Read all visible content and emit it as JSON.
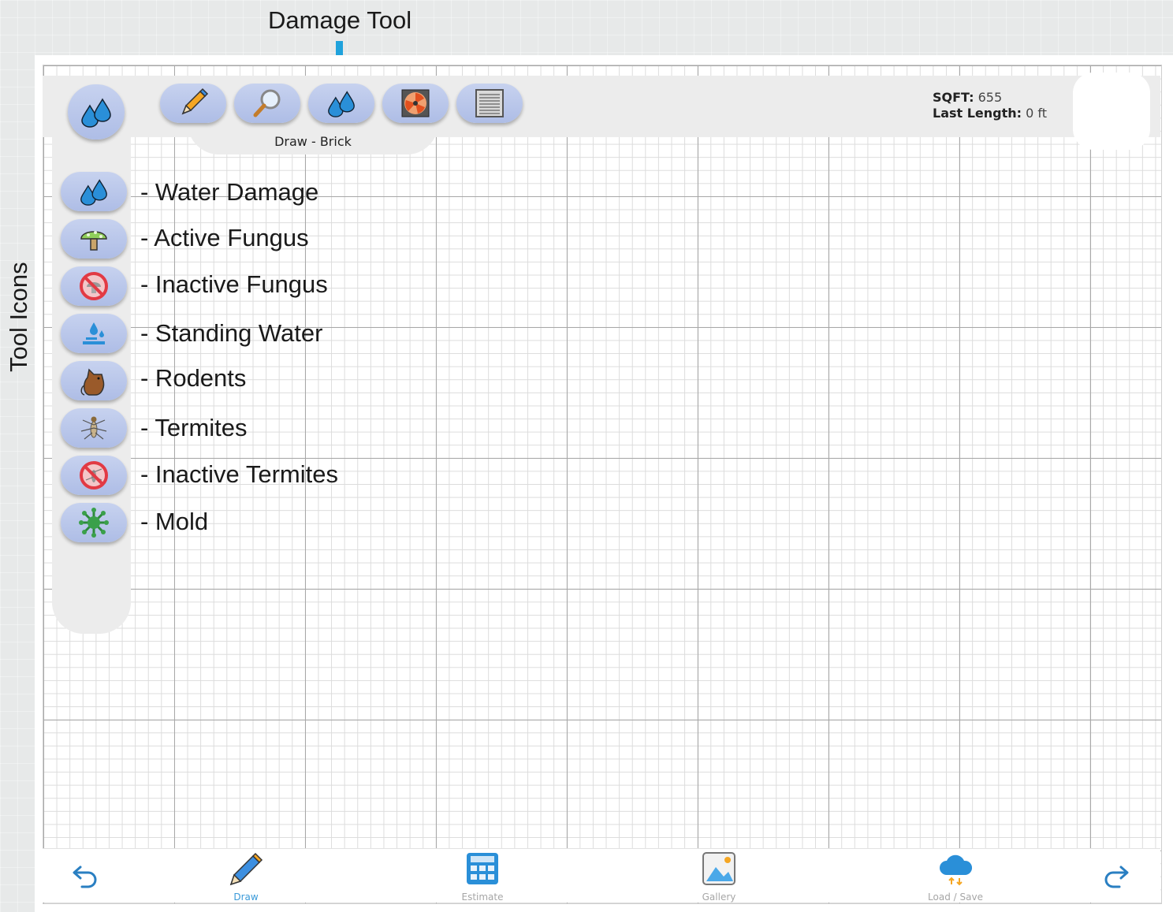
{
  "annotations": {
    "top_label": "Damage Tool",
    "left_label": "Tool Icons"
  },
  "toolbar": {
    "tools": [
      {
        "icon": "pencil-icon"
      },
      {
        "icon": "magnifier-icon"
      },
      {
        "icon": "water-drops-icon"
      },
      {
        "icon": "fan-icon"
      },
      {
        "icon": "panel-icon"
      }
    ],
    "caption": "Draw - Brick"
  },
  "stats": {
    "sqft_label": "SQFT:",
    "sqft_value": "655",
    "length_label": "Last Length:",
    "length_value": "0 ft"
  },
  "damage_tools": [
    {
      "label": "- Water Damage",
      "icon": "water-drops-icon"
    },
    {
      "label": "- Active Fungus",
      "icon": "mushroom-icon"
    },
    {
      "label": "- Inactive Fungus",
      "icon": "inactive-fungus-icon"
    },
    {
      "label": "- Standing Water",
      "icon": "standing-water-icon"
    },
    {
      "label": "- Rodents",
      "icon": "rodent-icon"
    },
    {
      "label": "- Termites",
      "icon": "termite-icon"
    },
    {
      "label": "- Inactive Termites",
      "icon": "inactive-termite-icon"
    },
    {
      "label": "- Mold",
      "icon": "mold-icon"
    }
  ],
  "bottom_nav": {
    "draw": "Draw",
    "estimate": "Estimate",
    "gallery": "Gallery",
    "load_save": "Load / Save"
  },
  "colors": {
    "accent": "#1fa2dc",
    "button": "#b8c5ea",
    "active_nav": "#3a9ad9"
  }
}
